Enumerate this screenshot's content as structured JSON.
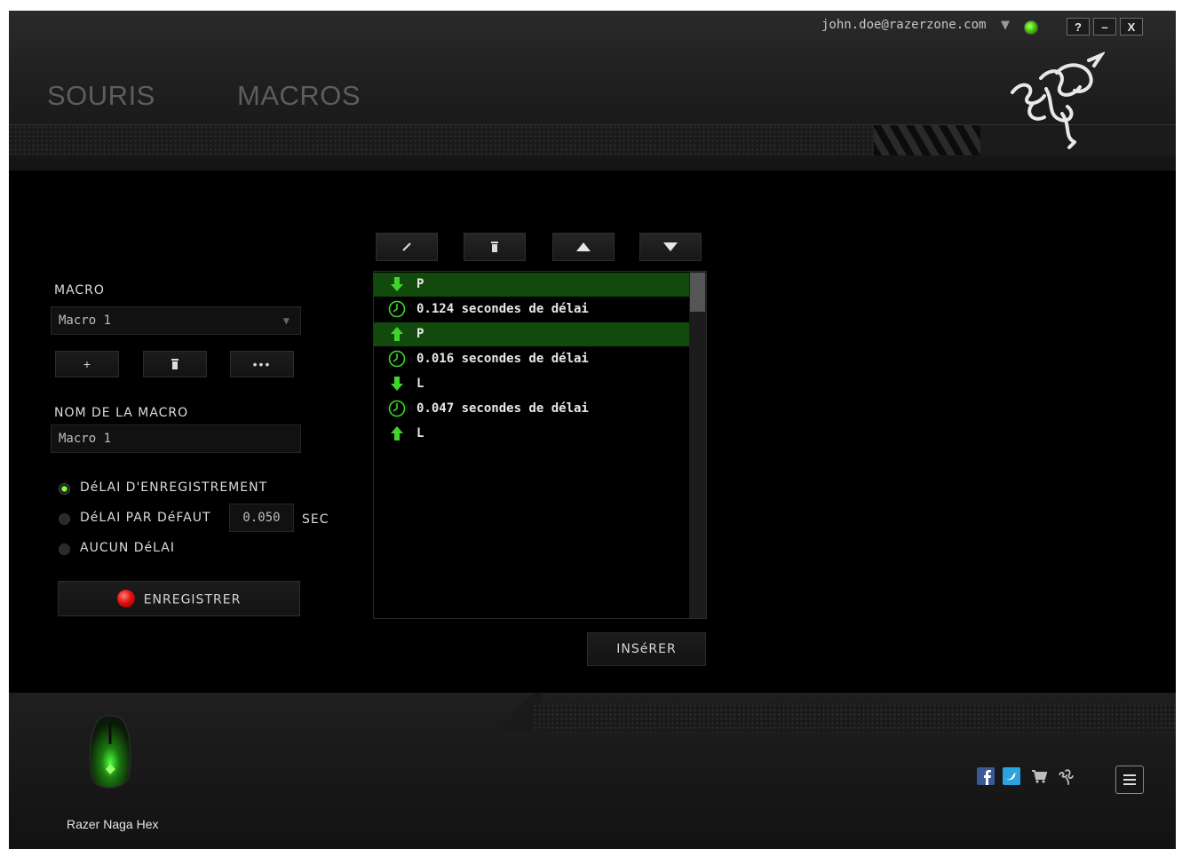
{
  "header": {
    "tabs": [
      {
        "label": "SOURIS"
      },
      {
        "label": "MACROS"
      }
    ],
    "user_email": "john.doe@razerzone.com",
    "window_buttons": {
      "help": "?",
      "minimize": "–",
      "close": "X"
    }
  },
  "macro_panel": {
    "macro_label": "MACRO",
    "selected_macro": "Macro 1",
    "add_label": "+",
    "more_label": "•••",
    "name_label": "NOM DE LA MACRO",
    "name_value": "Macro 1",
    "delay_options": [
      {
        "label": "DéLAI D'ENREGISTREMENT",
        "selected": true
      },
      {
        "label": "DéLAI PAR DéFAUT",
        "selected": false
      },
      {
        "label": "AUCUN DéLAI",
        "selected": false
      }
    ],
    "default_delay_value": "0.050",
    "delay_unit": "SEC",
    "record_label": "ENREGISTRER"
  },
  "event_list": {
    "items": [
      {
        "type": "key-down",
        "text": "P",
        "selected": true
      },
      {
        "type": "delay",
        "text": "0.124 secondes de délai",
        "selected": false
      },
      {
        "type": "key-up",
        "text": "P",
        "selected": true
      },
      {
        "type": "delay",
        "text": "0.016 secondes de délai",
        "selected": false
      },
      {
        "type": "key-down",
        "text": "L",
        "selected": false
      },
      {
        "type": "delay",
        "text": "0.047 secondes de délai",
        "selected": false
      },
      {
        "type": "key-up",
        "text": "L",
        "selected": false
      }
    ],
    "insert_label": "INSéRER"
  },
  "footer": {
    "device_name": "Razer Naga Hex"
  },
  "colors": {
    "accent_green": "#44d000",
    "selected_row": "#124a0e",
    "record_red": "#e01010"
  }
}
